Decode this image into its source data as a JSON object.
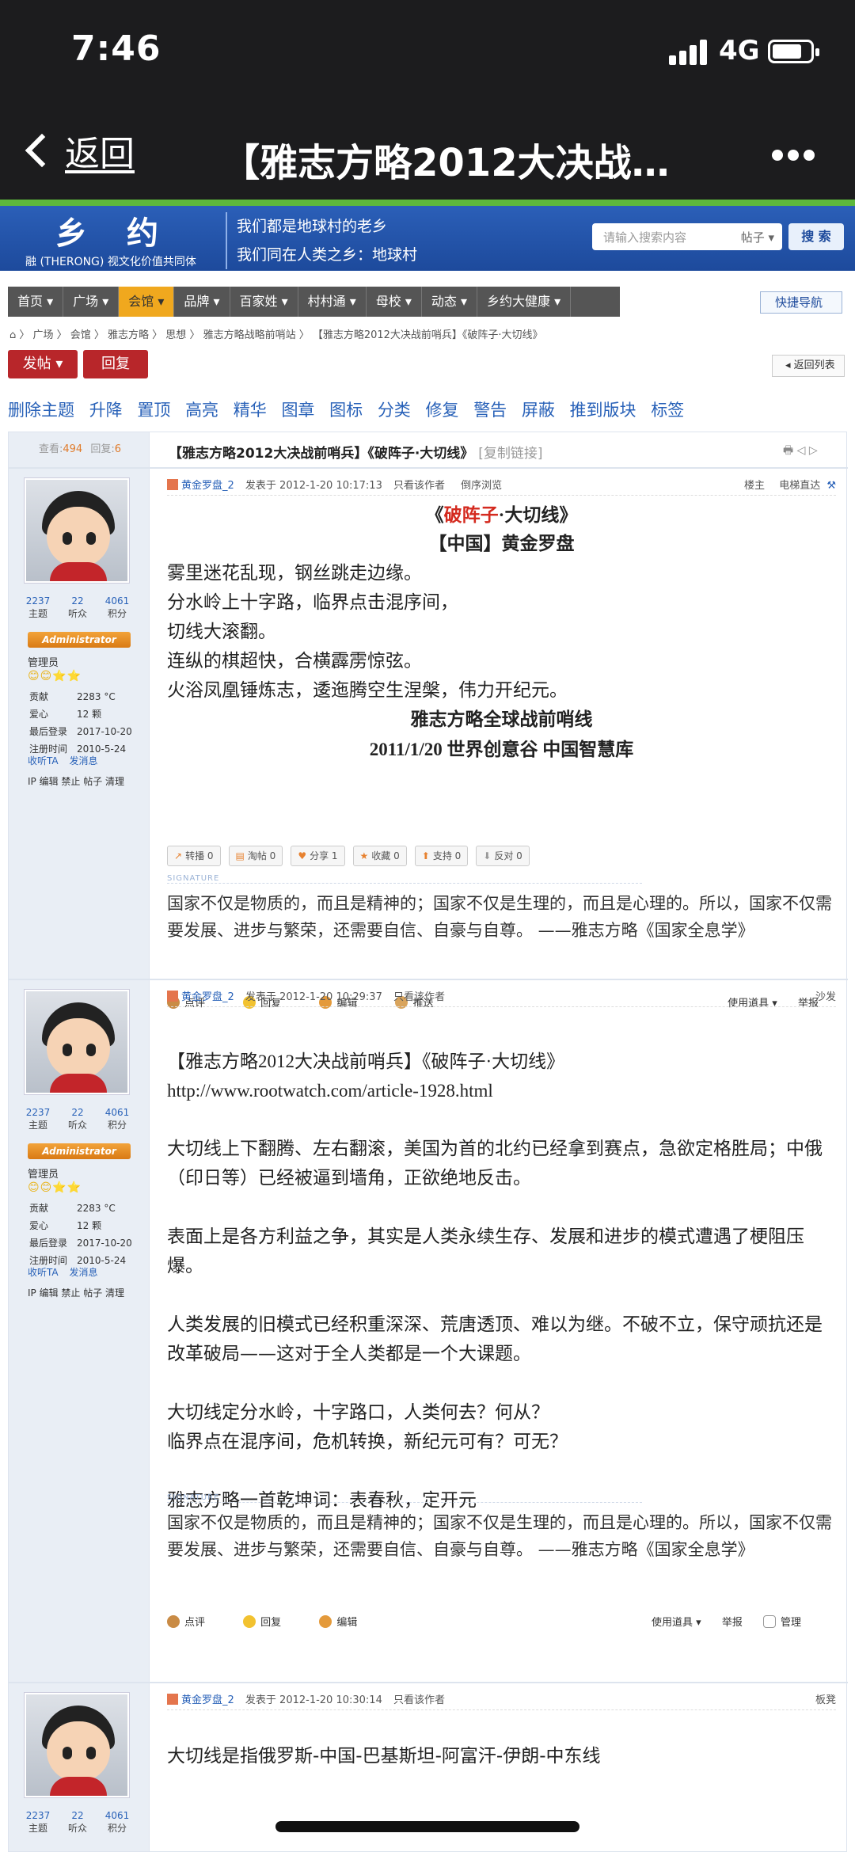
{
  "status": {
    "time": "7:46",
    "network": "4G"
  },
  "nav": {
    "back_label": "返回",
    "title": "【雅志方略2012大决战…"
  },
  "site": {
    "logo_big": "乡约",
    "logo_small": "融 (THERONG) 视文化价值共同体",
    "slogan1": "我们都是地球村的老乡",
    "slogan2": "我们同在人类之乡：地球村",
    "search_placeholder": "请输入搜索内容",
    "search_category": "帖子 ▾",
    "search_button": "搜 索"
  },
  "menu": [
    "首页 ▾",
    "广场 ▾",
    "会馆 ▾",
    "品牌 ▾",
    "百家姓 ▾",
    "村村通 ▾",
    "母校 ▾",
    "动态 ▾",
    "乡约大健康 ▾"
  ],
  "quicknav": "快捷导航",
  "breadcrumb": "⌂ 〉 广场 〉 会馆 〉 雅志方略 〉 思想 〉 雅志方略战略前哨站 〉 【雅志方略2012大决战前哨兵】《破阵子·大切线》",
  "buttons": {
    "post": "发帖 ▾",
    "reply": "回复",
    "back_list": "◂ 返回列表"
  },
  "mod_actions": [
    "删除主题",
    "升降",
    "置顶",
    "高亮",
    "精华",
    "图章",
    "图标",
    "分类",
    "修复",
    "警告",
    "屏蔽",
    "推到版块",
    "标签"
  ],
  "thread": {
    "views_label": "查看:",
    "views": "494",
    "replies_label": "回复:",
    "replies": "6",
    "title": "【雅志方略2012大决战前哨兵】《破阵子·大切线》",
    "copy_link": "[复制链接]"
  },
  "user": {
    "topics": "2237",
    "topics_label": "主题",
    "fans": "22",
    "fans_label": "听众",
    "points": "4061",
    "points_label": "积分",
    "badge": "Administrator",
    "group": "管理员",
    "stars": "😊😊⭐⭐",
    "contrib_label": "贡献",
    "contrib": "2283 °C",
    "love_label": "爱心",
    "love": "12 颗",
    "last_login_label": "最后登录",
    "last_login": "2017-10-20",
    "reg_label": "注册时间",
    "reg": "2010-5-24",
    "follow": "收听TA",
    "message": "发消息",
    "admin_links": "IP 编辑 禁止 帖子 清理"
  },
  "post1": {
    "author": "黄金罗盘_2",
    "time": "发表于 2012-1-20 10:17:13",
    "only_author": "只看该作者",
    "reverse": "倒序浏览",
    "floor": "楼主",
    "jump": "电梯直达",
    "title_pre": "《",
    "title_red": "破阵子",
    "title_post": "·大切线》",
    "subtitle": "【中国】黄金罗盘",
    "lines": [
      "雾里迷花乱现，钢丝跳走边缘。",
      "分水岭上十字路，临界点击混序间，",
      "切线大滚翻。",
      "连纵的棋超快，合横霹雳惊弦。",
      "火浴凤凰锤炼志，逶迤腾空生涅槃，伟力开纪元。"
    ],
    "sign1": "雅志方略全球战前哨线",
    "sign2": "2011/1/20 世界创意谷  中国智慧库",
    "share": [
      "转播 0",
      "淘帖 0",
      "分享 1",
      "收藏 0",
      "支持 0",
      "反对 0"
    ],
    "foot": [
      "点评",
      "回复",
      "编辑",
      "推送"
    ],
    "tools": "使用道具 ▾",
    "report": "举报"
  },
  "signature": {
    "label": "SIGNATURE",
    "text": "国家不仅是物质的，而且是精神的；国家不仅是生理的，而且是心理的。所以，国家不仅需要发展、进步与繁荣，还需要自信、自豪与自尊。 ——雅志方略《国家全息学》"
  },
  "post2": {
    "author": "黄金罗盘_2",
    "time": "发表于 2012-1-20 10:29:37",
    "only_author": "只看该作者",
    "floor": "沙发",
    "title": "【雅志方略2012大决战前哨兵】《破阵子·大切线》",
    "url": "http://www.rootwatch.com/article-1928.html",
    "p1": "大切线上下翻腾、左右翻滚，美国为首的北约已经拿到赛点，急欲定格胜局；中俄（印日等）已经被逼到墙角，正欲绝地反击。",
    "p2": "表面上是各方利益之争，其实是人类永续生存、发展和进步的模式遭遇了梗阻压爆。",
    "p3": "人类发展的旧模式已经积重深深、荒唐透顶、难以为继。不破不立，保守顽抗还是改革破局——这对于全人类都是一个大课题。",
    "p4a": "大切线定分水岭，十字路口，人类何去？何从？",
    "p4b": "临界点在混序间，危机转换，新纪元可有？可无？",
    "p5": "雅志方略一首乾坤词：表春秋，定开元",
    "foot": [
      "点评",
      "回复",
      "编辑"
    ],
    "tools": "使用道具 ▾",
    "report": "举报",
    "manage": "管理"
  },
  "post3": {
    "author": "黄金罗盘_2",
    "time": "发表于 2012-1-20 10:30:14",
    "only_author": "只看该作者",
    "floor": "板凳",
    "p1": "大切线是指俄罗斯-中国-巴基斯坦-阿富汗-伊朗-中东线"
  }
}
